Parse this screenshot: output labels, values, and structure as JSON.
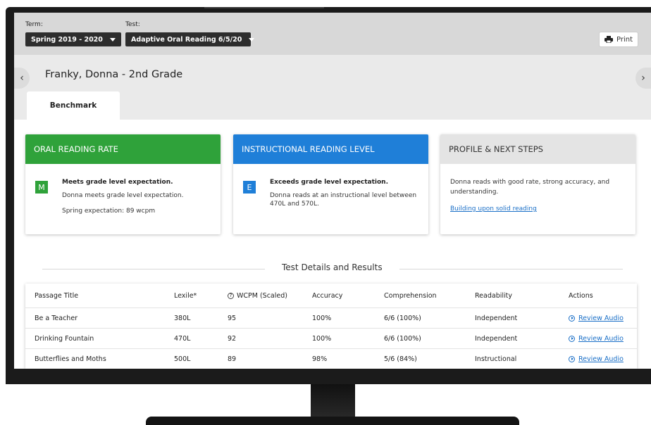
{
  "toolbar": {
    "term_label": "Term:",
    "term_value": "Spring 2019 - 2020",
    "test_label": "Test:",
    "test_value": "Adaptive Oral Reading 6/5/20",
    "print_label": "Print"
  },
  "student": {
    "name": "Franky, Donna - 2nd Grade",
    "prev_icon": "chevron-left-icon",
    "next_icon": "chevron-right-icon",
    "tab": "Benchmark"
  },
  "cards": {
    "oral_reading_rate": {
      "title": "ORAL READING RATE",
      "color": "#2fa23a",
      "badge": "M",
      "status": "Meets grade level expectation.",
      "detail": "Donna meets grade level expectation.",
      "expectation": "Spring expectation: 89 wcpm"
    },
    "instructional_level": {
      "title": "INSTRUCTIONAL READING LEVEL",
      "color": "#1f7fd8",
      "badge": "E",
      "status": "Exceeds grade level expectation.",
      "detail": "Donna reads at an instructional level between 470L and 570L."
    },
    "profile": {
      "title": "PROFILE & NEXT STEPS",
      "color": "#e4e4e4",
      "text": "Donna reads with good rate, strong accuracy, and understanding.",
      "link": "Building upon solid reading"
    }
  },
  "section_title": "Test Details and Results",
  "table": {
    "headers": [
      "Passage Title",
      "Lexile*",
      "WCPM (Scaled)",
      "Accuracy",
      "Comprehension",
      "Readability",
      "Actions"
    ],
    "rows": [
      {
        "title": "Be a Teacher",
        "lexile": "380L",
        "wcpm": "95",
        "accuracy": "100%",
        "comprehension": "6/6 (100%)",
        "readability": "Independent",
        "action": "Review Audio"
      },
      {
        "title": "Drinking Fountain",
        "lexile": "470L",
        "wcpm": "92",
        "accuracy": "100%",
        "comprehension": "6/6 (100%)",
        "readability": "Independent",
        "action": "Review Audio"
      },
      {
        "title": "Butterflies and Moths",
        "lexile": "500L",
        "wcpm": "89",
        "accuracy": "98%",
        "comprehension": "5/6 (84%)",
        "readability": "Instructional",
        "action": "Review Audio"
      }
    ]
  }
}
